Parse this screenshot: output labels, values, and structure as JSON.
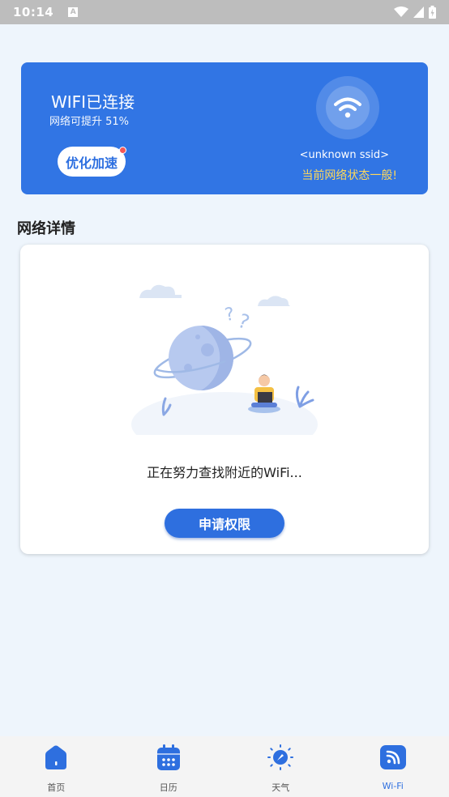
{
  "status_bar": {
    "time": "10:14",
    "notification_icon": "A"
  },
  "wifi_card": {
    "title": "WIFI已连接",
    "subtitle": "网络可提升 51%",
    "optimize_label": "优化加速",
    "ssid": "<unknown ssid>",
    "network_status": "当前网络状态一般!",
    "icon": "wifi-icon"
  },
  "details": {
    "section_title": "网络详情",
    "searching_text": "正在努力查找附近的WiFi...",
    "permission_label": "申请权限"
  },
  "bottom_nav": {
    "items": [
      {
        "label": "首页",
        "icon": "home-icon"
      },
      {
        "label": "日历",
        "icon": "calendar-icon"
      },
      {
        "label": "天气",
        "icon": "weather-icon"
      },
      {
        "label": "Wi-Fi",
        "icon": "wifi-tab-icon",
        "active": true
      }
    ]
  },
  "colors": {
    "accent": "#3175e4",
    "warning": "#ffd85a",
    "background": "#eef5fc"
  }
}
